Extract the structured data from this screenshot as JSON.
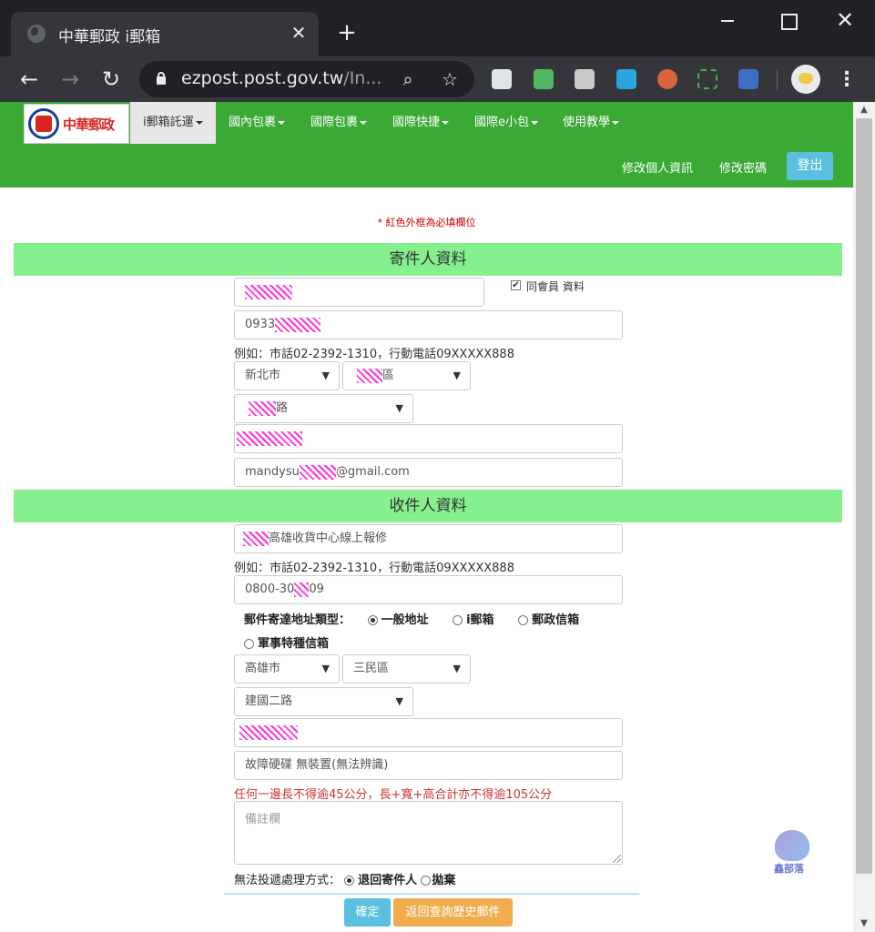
{
  "browser": {
    "tab_title": "中華郵政 i郵箱",
    "url_host": "ezpost.post.gov.tw",
    "url_rest": "/In...",
    "tab_close": "✕",
    "new_tab": "+",
    "window_close": "✕",
    "back": "←",
    "forward": "→",
    "reload": "↻",
    "zoom_icon": "⌕",
    "star_icon": "☆",
    "menu": "⋮"
  },
  "site": {
    "logo_text": "中華郵政",
    "menu": [
      {
        "label": "i郵箱託運"
      },
      {
        "label": "國內包裹"
      },
      {
        "label": "國際包裹"
      },
      {
        "label": "國際快捷"
      },
      {
        "label": "國際e小包"
      },
      {
        "label": "使用教學"
      }
    ],
    "edit_profile": "修改個人資訊",
    "change_password": "修改密碼",
    "logout": "登出"
  },
  "form": {
    "required_note": "* 紅色外框為必填欄位",
    "sender_header": "寄件人資料",
    "same_as_member": "同會員 資料",
    "same_as_member_checked": true,
    "sender_phone_prefix": "0933",
    "phone_hint": "例如：市話02-2392-1310，行動電話09XXXXX888",
    "sender_city": "新北市",
    "sender_district_suffix": "區",
    "sender_road_suffix": "路",
    "sender_email_prefix": "mandysu",
    "sender_email_suffix": "@gmail.com",
    "recipient_header": "收件人資料",
    "recipient_name": "高雄收貨中心線上報修",
    "recipient_phone_hint": "例如：市話02-2392-1310，行動電話09XXXXX888",
    "recipient_phone_prefix": "0800-30",
    "recipient_phone_suffix": "09",
    "address_type_label": "郵件寄達地址類型：",
    "address_types": [
      {
        "label": "一般地址",
        "selected": true
      },
      {
        "label": "i郵箱",
        "selected": false
      },
      {
        "label": "郵政信箱",
        "selected": false
      },
      {
        "label": "軍事特種信箱",
        "selected": false
      }
    ],
    "recipient_city": "高雄市",
    "recipient_district": "三民區",
    "recipient_road": "建國二路",
    "item_content": "故障硬碟 無裝置(無法辨識)",
    "size_limit_note": "任何一邊長不得逾45公分，長+寬+高合計亦不得逾105公分",
    "remarks_placeholder": "備註欄",
    "undeliverable_label": "無法投遞處理方式：",
    "undeliverable_options": [
      {
        "label": "退回寄件人",
        "selected": true
      },
      {
        "label": "拋棄",
        "selected": false
      }
    ],
    "confirm_button": "確定",
    "back_button": "返回查詢歷史郵件"
  },
  "watermark_text": "鑫部落",
  "colors": {
    "nav_green": "#3aaa35",
    "section_green": "#86f08e",
    "info_button": "#5bc0de",
    "warning_button": "#f0ad4e",
    "required_red": "#cc0000",
    "redaction_magenta": "#ff00d0"
  }
}
